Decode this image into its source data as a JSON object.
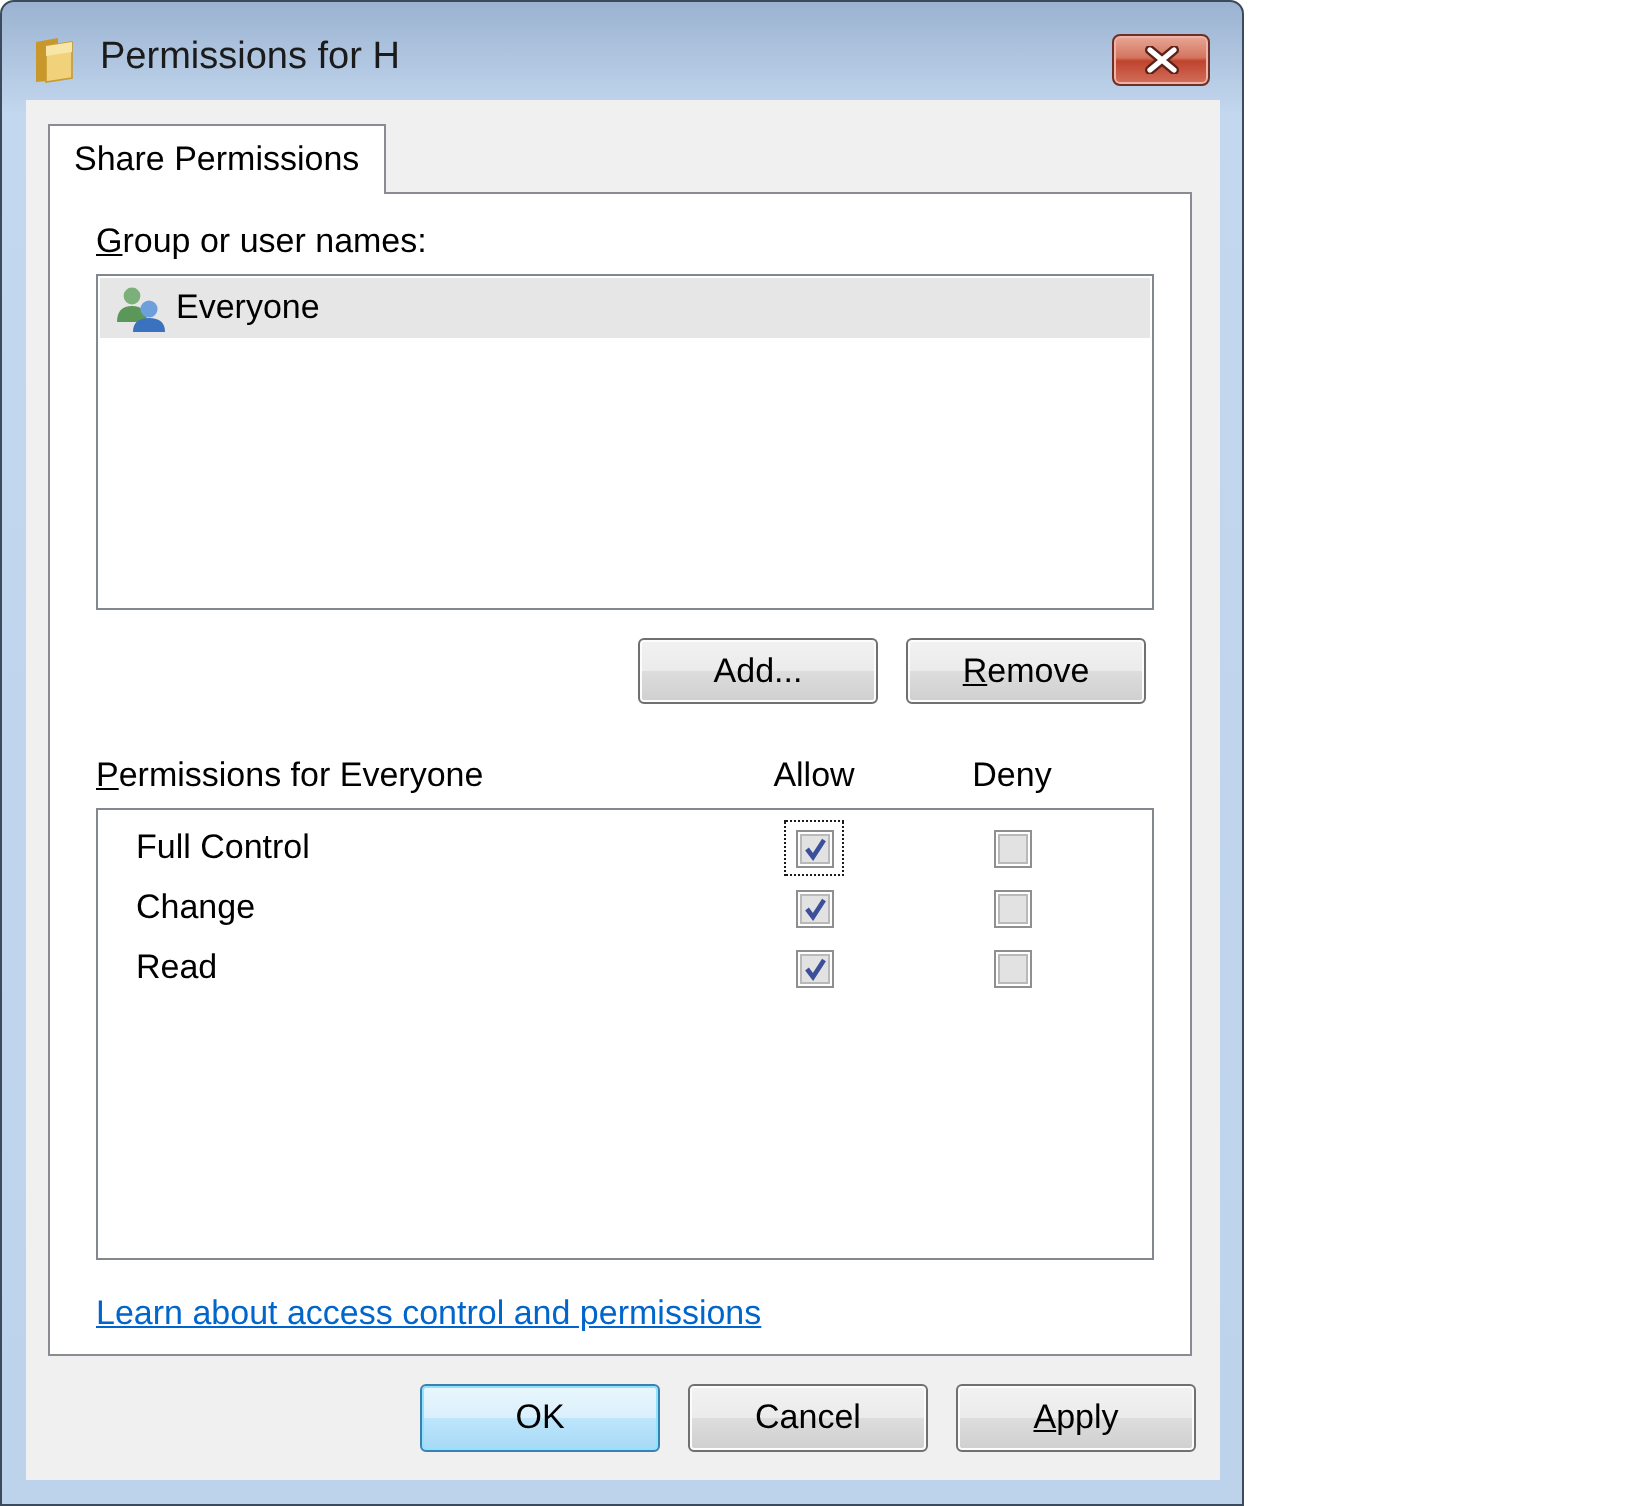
{
  "window": {
    "title": "Permissions for H"
  },
  "tabs": [
    {
      "label": "Share Permissions",
      "selected": true
    }
  ],
  "group_list": {
    "label": "Group or user names:",
    "label_mnemonic": true,
    "items": [
      {
        "name": "Everyone",
        "selected": true
      }
    ]
  },
  "list_buttons": [
    {
      "label": "Add...",
      "mnemonic": false
    },
    {
      "label": "Remove",
      "mnemonic": true
    }
  ],
  "permissions": {
    "label": "Permissions for Everyone",
    "label_mnemonic": true,
    "columns": [
      "Allow",
      "Deny"
    ],
    "rows": [
      {
        "name": "Full Control",
        "checks": [
          {
            "checked": true,
            "focused": true
          },
          {
            "checked": false,
            "focused": false
          }
        ]
      },
      {
        "name": "Change",
        "checks": [
          {
            "checked": true,
            "focused": false
          },
          {
            "checked": false,
            "focused": false
          }
        ]
      },
      {
        "name": "Read",
        "checks": [
          {
            "checked": true,
            "focused": false
          },
          {
            "checked": false,
            "focused": false
          }
        ]
      }
    ]
  },
  "help_link": "Learn about access control and permissions",
  "buttons": [
    {
      "label": "OK",
      "default": true,
      "mnemonic": false
    },
    {
      "label": "Cancel",
      "default": false,
      "mnemonic": false
    },
    {
      "label": "Apply",
      "default": false,
      "mnemonic": true
    }
  ]
}
